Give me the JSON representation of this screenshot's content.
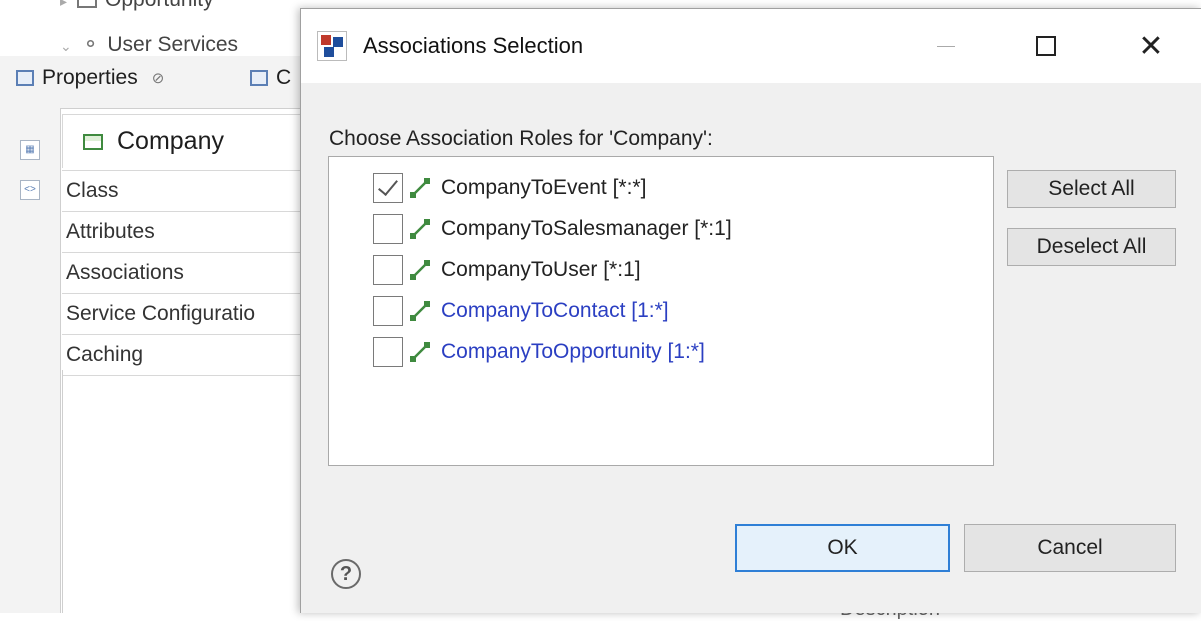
{
  "background": {
    "tree_items": [
      "Opportunity",
      "User Services"
    ],
    "tabs": [
      {
        "label": "Properties",
        "icon": "properties-icon"
      },
      {
        "label": "C",
        "icon": "console-icon"
      }
    ],
    "properties_header": "Company",
    "property_sections": [
      "Class",
      "Attributes",
      "Associations",
      "Service Configuratio",
      "Caching"
    ],
    "bottom_partial": "Description"
  },
  "dialog": {
    "title": "Associations Selection",
    "prompt": "Choose Association Roles for 'Company':",
    "associations": [
      {
        "label": "CompanyToEvent  [*:*]",
        "checked": true,
        "style": "dark"
      },
      {
        "label": "CompanyToSalesmanager  [*:1]",
        "checked": false,
        "style": "dark"
      },
      {
        "label": "CompanyToUser  [*:1]",
        "checked": false,
        "style": "dark"
      },
      {
        "label": "CompanyToContact  [1:*]",
        "checked": false,
        "style": "blue"
      },
      {
        "label": "CompanyToOpportunity  [1:*]",
        "checked": false,
        "style": "blue"
      }
    ],
    "select_all_label": "Select All",
    "deselect_all_label": "Deselect All",
    "help_glyph": "?",
    "ok_label": "OK",
    "cancel_label": "Cancel",
    "colors": {
      "link_blue": "#2b3fc2",
      "accent": "#2f7fd6",
      "assoc_icon_green": "#3f8a3f"
    }
  }
}
